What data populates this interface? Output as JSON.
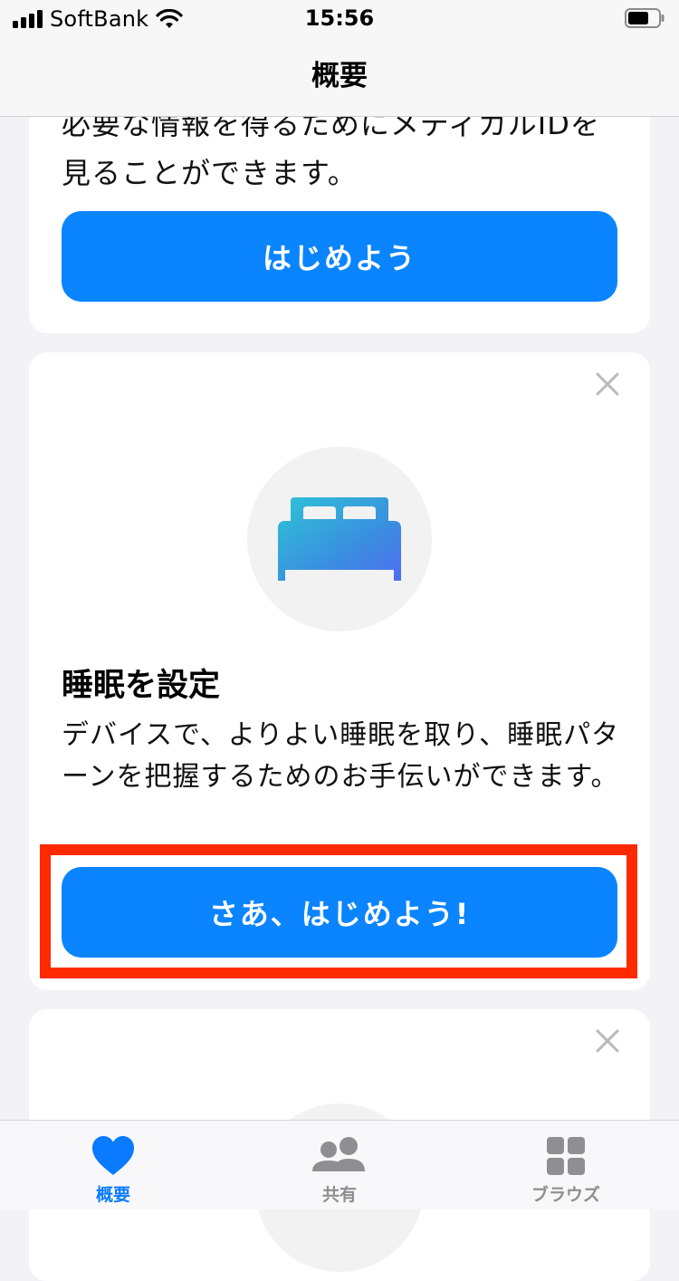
{
  "status_bar": {
    "carrier": "SoftBank",
    "time": "15:56",
    "icons": [
      "signal-icon",
      "wifi-icon",
      "battery-icon"
    ]
  },
  "nav": {
    "title": "概要"
  },
  "cards": [
    {
      "partial_text": "必要な情報を得るためにメディカルIDを見ることができます。",
      "button": "はじめよう"
    },
    {
      "icon": "bed-icon",
      "title": "睡眠を設定",
      "description": "デバイスで、よりよい睡眠を取り、睡眠パターンを把握するためのお手伝いができます。",
      "button": "さあ、はじめよう!",
      "close_icon": "close-icon"
    },
    {
      "close_icon": "close-icon"
    }
  ],
  "tabs": [
    {
      "label": "概要",
      "icon": "heart-icon",
      "active": true
    },
    {
      "label": "共有",
      "icon": "people-icon",
      "active": false
    },
    {
      "label": "ブラウズ",
      "icon": "grid-icon",
      "active": false
    }
  ],
  "colors": {
    "accent": "#0a84ff",
    "highlight": "#ff2a00",
    "background": "#f2f2f7",
    "inactive_tab": "#8e8e93"
  }
}
